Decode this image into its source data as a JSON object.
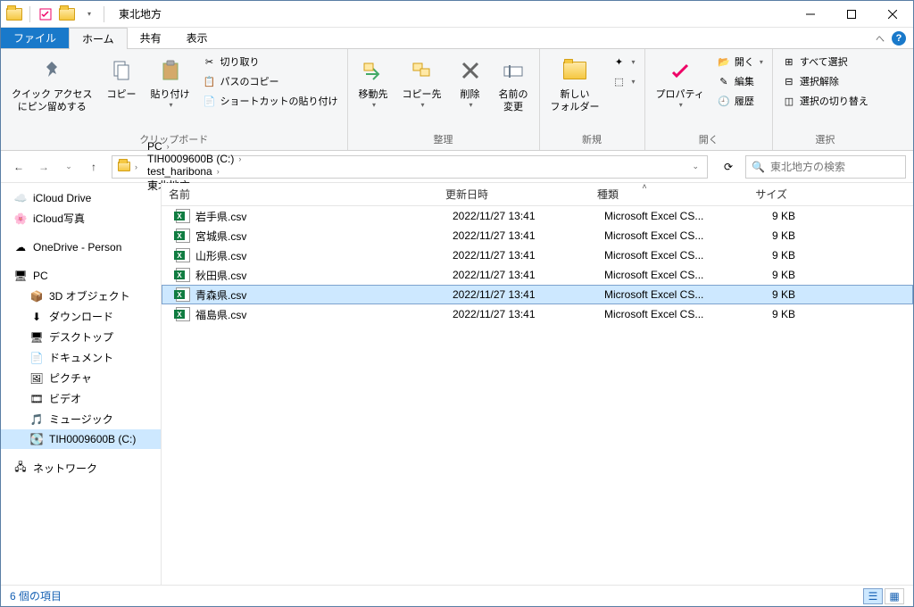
{
  "window": {
    "title": "東北地方"
  },
  "tabs": {
    "file": "ファイル",
    "home": "ホーム",
    "share": "共有",
    "view": "表示"
  },
  "ribbon": {
    "clipboard": {
      "label": "クリップボード",
      "pin": "クイック アクセス\nにピン留めする",
      "copy": "コピー",
      "paste": "貼り付け",
      "cut": "切り取り",
      "copypath": "パスのコピー",
      "pasteshortcut": "ショートカットの貼り付け"
    },
    "organize": {
      "label": "整理",
      "moveto": "移動先",
      "copyto": "コピー先",
      "delete": "削除",
      "rename": "名前の\n変更"
    },
    "new": {
      "label": "新規",
      "newfolder": "新しい\nフォルダー",
      "newitem": "新しいアイテム",
      "easyaccess": "ショートカット"
    },
    "open": {
      "label": "開く",
      "properties": "プロパティ",
      "open": "開く",
      "edit": "編集",
      "history": "履歴"
    },
    "select": {
      "label": "選択",
      "selectall": "すべて選択",
      "selectnone": "選択解除",
      "invert": "選択の切り替え"
    }
  },
  "breadcrumb": {
    "items": [
      "PC",
      "TIH0009600B (C:)",
      "test_haribona",
      "東北地方"
    ]
  },
  "search": {
    "placeholder": "東北地方の検索"
  },
  "tree": {
    "items": [
      {
        "label": "iCloud Drive",
        "icon": "cloud",
        "indent": 0
      },
      {
        "label": "iCloud写真",
        "icon": "photos",
        "indent": 0
      },
      {
        "label": "OneDrive - Person",
        "icon": "onedrive",
        "indent": 0,
        "spacer_before": true
      },
      {
        "label": "PC",
        "icon": "pc",
        "indent": 0,
        "spacer_before": true
      },
      {
        "label": "3D オブジェクト",
        "icon": "3d",
        "indent": 1
      },
      {
        "label": "ダウンロード",
        "icon": "download",
        "indent": 1
      },
      {
        "label": "デスクトップ",
        "icon": "desktop",
        "indent": 1
      },
      {
        "label": "ドキュメント",
        "icon": "document",
        "indent": 1
      },
      {
        "label": "ピクチャ",
        "icon": "picture",
        "indent": 1
      },
      {
        "label": "ビデオ",
        "icon": "video",
        "indent": 1
      },
      {
        "label": "ミュージック",
        "icon": "music",
        "indent": 1
      },
      {
        "label": "TIH0009600B (C:)",
        "icon": "disk",
        "indent": 1,
        "selected": true
      },
      {
        "label": "ネットワーク",
        "icon": "network",
        "indent": 0,
        "spacer_before": true
      }
    ]
  },
  "columns": {
    "name": "名前",
    "date": "更新日時",
    "type": "種類",
    "size": "サイズ"
  },
  "files": [
    {
      "name": "岩手県.csv",
      "date": "2022/11/27 13:41",
      "type": "Microsoft Excel CS...",
      "size": "9 KB",
      "selected": false
    },
    {
      "name": "宮城県.csv",
      "date": "2022/11/27 13:41",
      "type": "Microsoft Excel CS...",
      "size": "9 KB",
      "selected": false
    },
    {
      "name": "山形県.csv",
      "date": "2022/11/27 13:41",
      "type": "Microsoft Excel CS...",
      "size": "9 KB",
      "selected": false
    },
    {
      "name": "秋田県.csv",
      "date": "2022/11/27 13:41",
      "type": "Microsoft Excel CS...",
      "size": "9 KB",
      "selected": false
    },
    {
      "name": "青森県.csv",
      "date": "2022/11/27 13:41",
      "type": "Microsoft Excel CS...",
      "size": "9 KB",
      "selected": true
    },
    {
      "name": "福島県.csv",
      "date": "2022/11/27 13:41",
      "type": "Microsoft Excel CS...",
      "size": "9 KB",
      "selected": false
    }
  ],
  "status": {
    "count": "6 個の項目"
  }
}
